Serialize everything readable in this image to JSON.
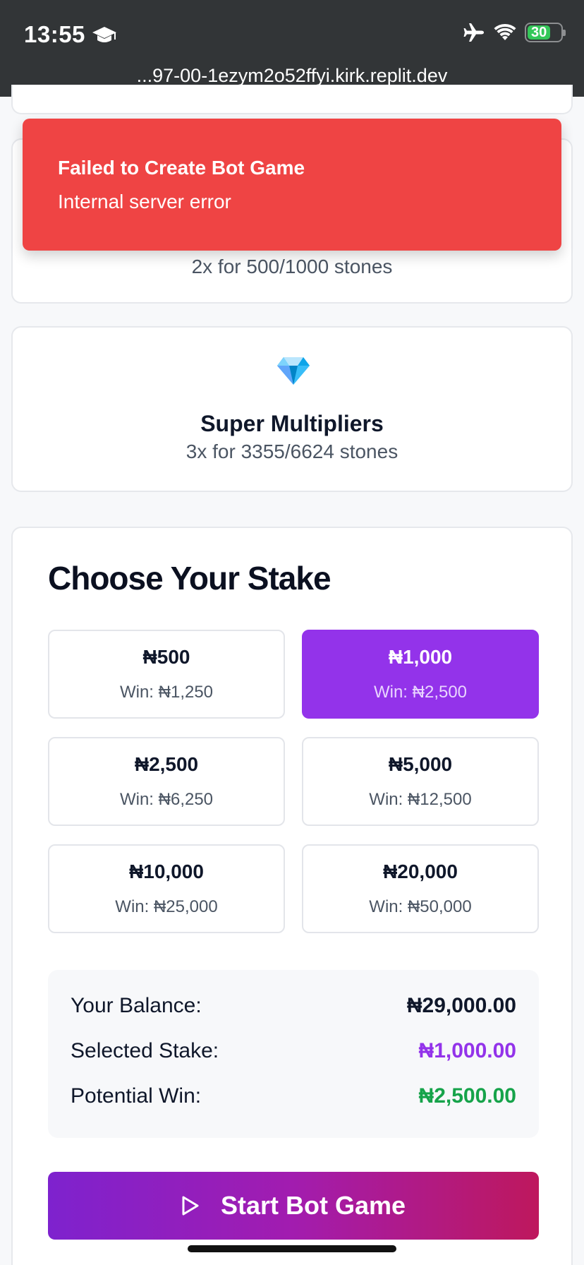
{
  "status_bar": {
    "time": "13:55",
    "battery": "30",
    "url": "...97-00-1ezym2o52ffyi.kirk.replit.dev"
  },
  "icons": [
    "graduation-cap-icon",
    "airplane-icon",
    "wifi-icon",
    "battery-icon",
    "gem-icon",
    "play-icon"
  ],
  "toast": {
    "title": "Failed to Create Bot Game",
    "message": "Internal server error"
  },
  "multipliers_card": {
    "subtitle": "2x for 500/1000 stones"
  },
  "super_card": {
    "title": "Super Multipliers",
    "subtitle": "3x for 3355/6624 stones"
  },
  "stake": {
    "heading": "Choose Your Stake",
    "options": [
      {
        "amount": "₦500",
        "win": "Win: ₦1,250"
      },
      {
        "amount": "₦1,000",
        "win": "Win: ₦2,500"
      },
      {
        "amount": "₦2,500",
        "win": "Win: ₦6,250"
      },
      {
        "amount": "₦5,000",
        "win": "Win: ₦12,500"
      },
      {
        "amount": "₦10,000",
        "win": "Win: ₦25,000"
      },
      {
        "amount": "₦20,000",
        "win": "Win: ₦50,000"
      }
    ],
    "selected_index": 1
  },
  "summary": {
    "balance_label": "Your Balance:",
    "balance_value": "₦29,000.00",
    "stake_label": "Selected Stake:",
    "stake_value": "₦1,000.00",
    "win_label": "Potential Win:",
    "win_value": "₦2,500.00"
  },
  "start_button": {
    "label": "Start Bot Game"
  },
  "colors": {
    "accent": "#9333ea",
    "error": "#ef4444",
    "success": "#16a34a",
    "button_gradient_start": "#7e22ce",
    "button_gradient_end": "#be185d"
  }
}
